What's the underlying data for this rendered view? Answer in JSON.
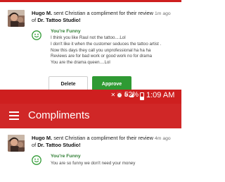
{
  "colors": {
    "brand_red": "#d02727",
    "approve_green": "#2f9a33",
    "compliment_green": "#2e7d32"
  },
  "notifications": [
    {
      "sender": "Hugo M.",
      "headline_mid": " sent Christian a compliment for their review of ",
      "business": "Dr. Tattoo Studio!",
      "time": "1m ago",
      "avatar_icon": "profile-photo",
      "compliment_icon": "smiley-icon",
      "compliment_title": "You're Funny",
      "body": [
        "I think you like Raul not the tattoo....Lol",
        "I don't like it when the customer seduces the tattoo artist .",
        "Now this days they call you unprofessional ha ha ha",
        "Reviews are for bad work or good work no for drama",
        "You are the drama queen....Lol"
      ],
      "buttons": {
        "delete": "Delete",
        "approve": "Approve"
      }
    },
    {
      "sender": "Hugo M.",
      "headline_mid": " sent Christian a compliment for their review of ",
      "business": "Dr. Tattoo Studio!",
      "time": "4m ago",
      "avatar_icon": "profile-photo",
      "compliment_icon": "smiley-icon",
      "compliment_title": "You're Funny",
      "body": [
        "You are so funny we don't need your money"
      ]
    }
  ],
  "status_bar": {
    "icons": [
      "bluetooth-off-icon",
      "alarm-icon",
      "wifi-icon",
      "signal-icon"
    ],
    "battery": "52%",
    "time": "1:09 AM"
  },
  "app_bar": {
    "menu_icon": "hamburger-menu-icon",
    "title": "Compliments"
  }
}
